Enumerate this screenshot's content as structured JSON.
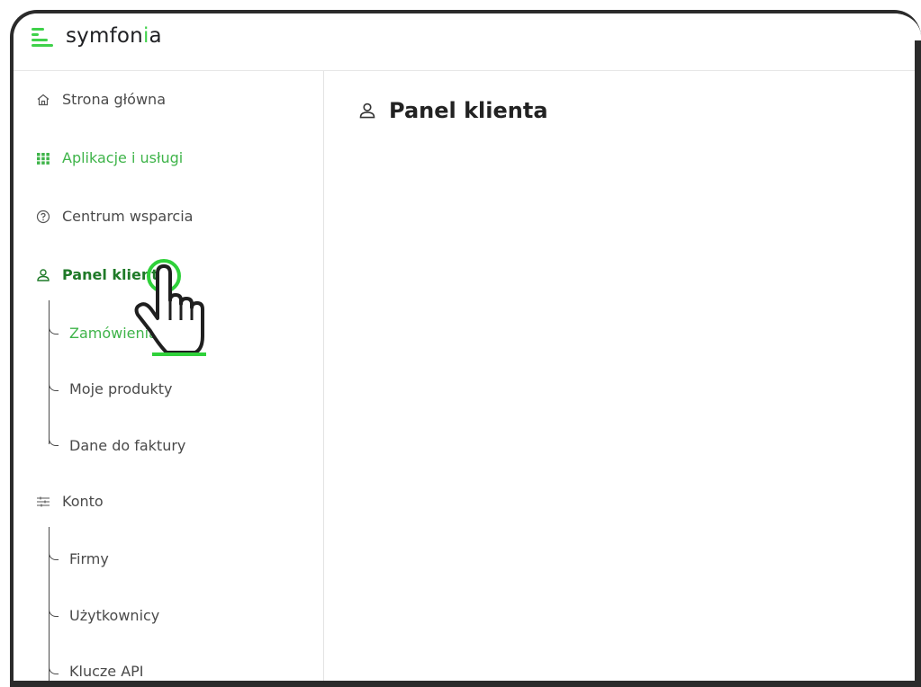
{
  "app": {
    "logo_text_prefix": "symfon",
    "logo_text_accent": "i",
    "logo_text_suffix": "a"
  },
  "sidebar": {
    "items": [
      {
        "label": "Strona główna",
        "icon": "home-icon"
      },
      {
        "label": "Aplikacje i usługi",
        "icon": "apps-grid-icon"
      },
      {
        "label": "Centrum wsparcia",
        "icon": "help-icon"
      },
      {
        "label": "Panel klienta",
        "icon": "user-icon"
      },
      {
        "label": "Konto",
        "icon": "sliders-icon"
      }
    ],
    "panel_sub": [
      "Zamówienia",
      "Moje produkty",
      "Dane do faktury"
    ],
    "konto_sub": [
      "Firmy",
      "Użytkownicy",
      "Klucze API"
    ]
  },
  "main": {
    "title": "Panel klienta",
    "title_icon": "user-icon"
  },
  "colors": {
    "accent": "#3fd14a",
    "accent_text": "#3fb44a",
    "frame": "#2b2b2b"
  }
}
